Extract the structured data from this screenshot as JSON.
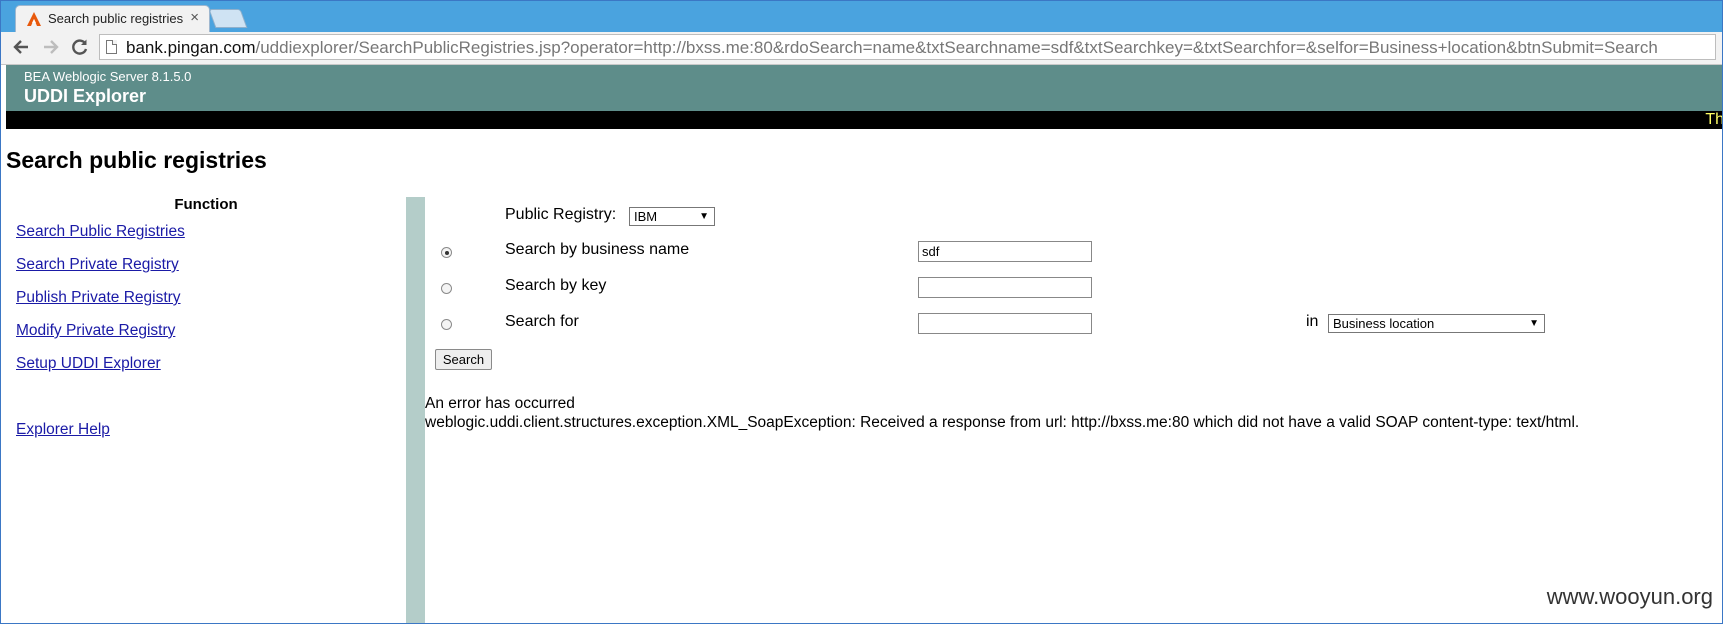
{
  "browser": {
    "tab_title": "Search public registries",
    "tab_close": "×",
    "url_host": "bank.pingan.com",
    "url_path": "/uddiexplorer/SearchPublicRegistries.jsp?operator=http://bxss.me:80&rdoSearch=name&txtSearchname=sdf&txtSearchkey=&txtSearchfor=&selfor=Business+location&btnSubmit=Search",
    "icons": {
      "back": "back-arrow-icon",
      "forward": "forward-arrow-icon",
      "reload": "reload-icon",
      "page": "page-icon"
    }
  },
  "header": {
    "product": "BEA Weblogic Server 8.1.5.0",
    "app": "UDDI Explorer",
    "ticker": "Th"
  },
  "page_title": "Search public registries",
  "sidebar": {
    "heading": "Function",
    "items": [
      {
        "label": "Search Public Registries"
      },
      {
        "label": "Search Private Registry"
      },
      {
        "label": "Publish Private Registry"
      },
      {
        "label": "Modify Private Registry"
      },
      {
        "label": "Setup UDDI Explorer"
      },
      {
        "label": "Explorer Help"
      }
    ]
  },
  "form": {
    "registry_label": "Public Registry:",
    "registry_value": "IBM",
    "options": [
      {
        "label": "Search by business name",
        "value": "sdf",
        "selected": true
      },
      {
        "label": "Search by key",
        "value": "",
        "selected": false
      },
      {
        "label": "Search for",
        "value": "",
        "selected": false
      }
    ],
    "in_label": "in",
    "in_value": "Business location",
    "submit_label": "Search"
  },
  "error": {
    "title": "An error has occurred",
    "detail": "weblogic.uddi.client.structures.exception.XML_SoapException: Received a response from url: http://bxss.me:80 which did not have a valid SOAP content-type: text/html."
  },
  "watermark": "www.wooyun.org",
  "colors": {
    "banner": "#5e8d8a",
    "sidebar_strip": "#b4cdc9",
    "link": "#1a1aa6",
    "ticker": "#ffff66",
    "tabstrip": "#4aa3df"
  }
}
